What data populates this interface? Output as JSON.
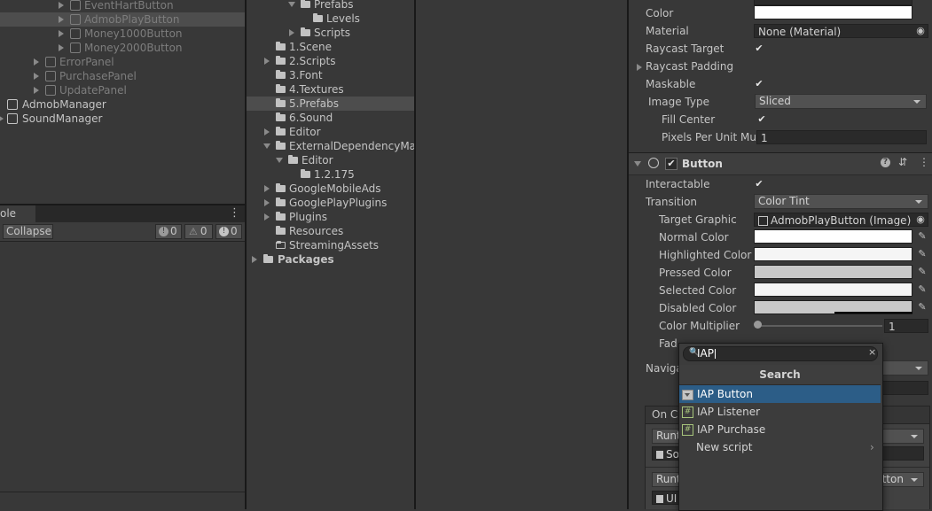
{
  "hierarchy": {
    "items": [
      {
        "label": "EventHartButton"
      },
      {
        "label": "AdmobPlayButton"
      },
      {
        "label": "Money1000Button"
      },
      {
        "label": "Money2000Button"
      },
      {
        "label": "ErrorPanel"
      },
      {
        "label": "PurchasePanel"
      },
      {
        "label": "UpdatePanel"
      },
      {
        "label": "AdmobManager"
      },
      {
        "label": "SoundManager"
      }
    ]
  },
  "console": {
    "tab_label": "ole",
    "collapse_label": "Collapse",
    "info_count": "0",
    "warn_count": "0",
    "error_count": "0",
    "menu_icon": "⋮"
  },
  "project": {
    "items": [
      {
        "label": "Prefabs"
      },
      {
        "label": "Levels"
      },
      {
        "label": "Scripts"
      },
      {
        "label": "1.Scene"
      },
      {
        "label": "2.Scripts"
      },
      {
        "label": "3.Font"
      },
      {
        "label": "4.Textures"
      },
      {
        "label": "5.Prefabs"
      },
      {
        "label": "6.Sound"
      },
      {
        "label": "Editor"
      },
      {
        "label": "ExternalDependencyMar"
      },
      {
        "label": "Editor"
      },
      {
        "label": "1.2.175"
      },
      {
        "label": "GoogleMobileAds"
      },
      {
        "label": "GooglePlayPlugins"
      },
      {
        "label": "Plugins"
      },
      {
        "label": "Resources"
      },
      {
        "label": "StreamingAssets"
      },
      {
        "label": "Packages"
      }
    ]
  },
  "inspector": {
    "image": {
      "color_label": "Color",
      "material_label": "Material",
      "material_value": "None (Material)",
      "raycast_target_label": "Raycast Target",
      "raycast_padding_label": "Raycast Padding",
      "maskable_label": "Maskable",
      "image_type_label": "Image Type",
      "image_type_value": "Sliced",
      "fill_center_label": "Fill Center",
      "ppu_label": "Pixels Per Unit Mul",
      "ppu_value": "1"
    },
    "button": {
      "header": "Button",
      "interactable_label": "Interactable",
      "transition_label": "Transition",
      "transition_value": "Color Tint",
      "target_graphic_label": "Target Graphic",
      "target_graphic_value": "AdmobPlayButton (Image)",
      "normal_color_label": "Normal Color",
      "highlighted_color_label": "Highlighted Color",
      "pressed_color_label": "Pressed Color",
      "selected_color_label": "Selected Color",
      "disabled_color_label": "Disabled Color",
      "color_multiplier_label": "Color Multiplier",
      "color_multiplier_value": "1",
      "fade_label": "Fad",
      "navigation_label": "Naviga",
      "onclick_label": "On Cl",
      "runtime_label_1": "Runt",
      "runtime_label_2": "Runt",
      "obj_1": "So",
      "obj_2": "UI",
      "func_2": "utton",
      "normal_color": "#ffffff",
      "highlighted_color": "#f5f5f5",
      "pressed_color": "#c8c8c8",
      "selected_color": "#f5f5f5",
      "disabled_color": "#c8c8c8"
    }
  },
  "search_popup": {
    "query": "IAP",
    "title": "Search",
    "results": [
      {
        "label": "IAP Button",
        "icon": "button-icon"
      },
      {
        "label": "IAP Listener",
        "icon": "script-icon"
      },
      {
        "label": "IAP Purchase",
        "icon": "script-icon"
      },
      {
        "label": "New script",
        "icon": "none"
      }
    ]
  }
}
